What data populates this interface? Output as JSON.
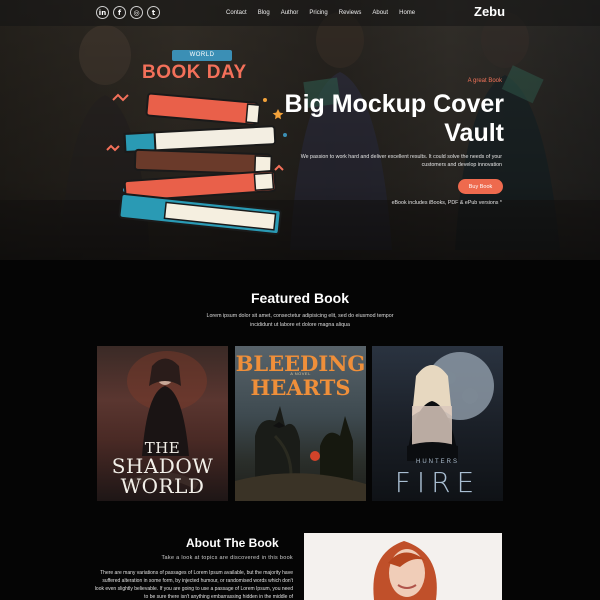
{
  "header": {
    "social_icons": [
      "linkedin-icon",
      "facebook-icon",
      "instagram-icon",
      "twitter-icon"
    ],
    "social_glyphs": [
      "in",
      "f",
      "◎",
      "t"
    ],
    "nav": [
      "Contact",
      "Blog",
      "Author",
      "Pricing",
      "Reviews",
      "About",
      "Home"
    ],
    "brand": "Zebu"
  },
  "hero": {
    "badge_top": "WORLD",
    "badge_main": "BOOK DAY",
    "kicker": "A great Book",
    "headline": "Big Mockup Cover Vault",
    "blurb": "We passion to work hard and deliver excellent results. It could solve the needs of your customers and develop innovation",
    "cta": "Buy Book",
    "formats": "eBook includes iBooks, PDF & ePub versions *"
  },
  "featured": {
    "title": "Featured Book",
    "subtitle": "Lorem ipsum dolor sit amet, consectetur adipisicing elit, sed do eiusmod tempor incididunt ut labore et dolore magna aliqua",
    "books": [
      {
        "line1": "THE",
        "line2": "SHADOW",
        "line3": "WORLD"
      },
      {
        "line1": "BLEEDING",
        "tagline": "A NOVEL",
        "line2": "HEARTS"
      },
      {
        "line1": "HUNTERS",
        "line2": "FIRE"
      }
    ]
  },
  "about": {
    "title": "About The Book",
    "subtitle": "Take a look at topics are discovered in this book",
    "body": "There are many variations of passages of Lorem Ipsum available, but the majority have suffered alteration in some form, by injected humour, or randomised words which don't look even slightly believable. If you are going to use a passage of Lorem Ipsum, you need to be sure there isn't anything embarrassing hidden in the middle of"
  },
  "colors": {
    "accent": "#ee6a4e",
    "background": "#050505",
    "book_red": "#e9604a",
    "book_teal": "#2a9ab4"
  }
}
